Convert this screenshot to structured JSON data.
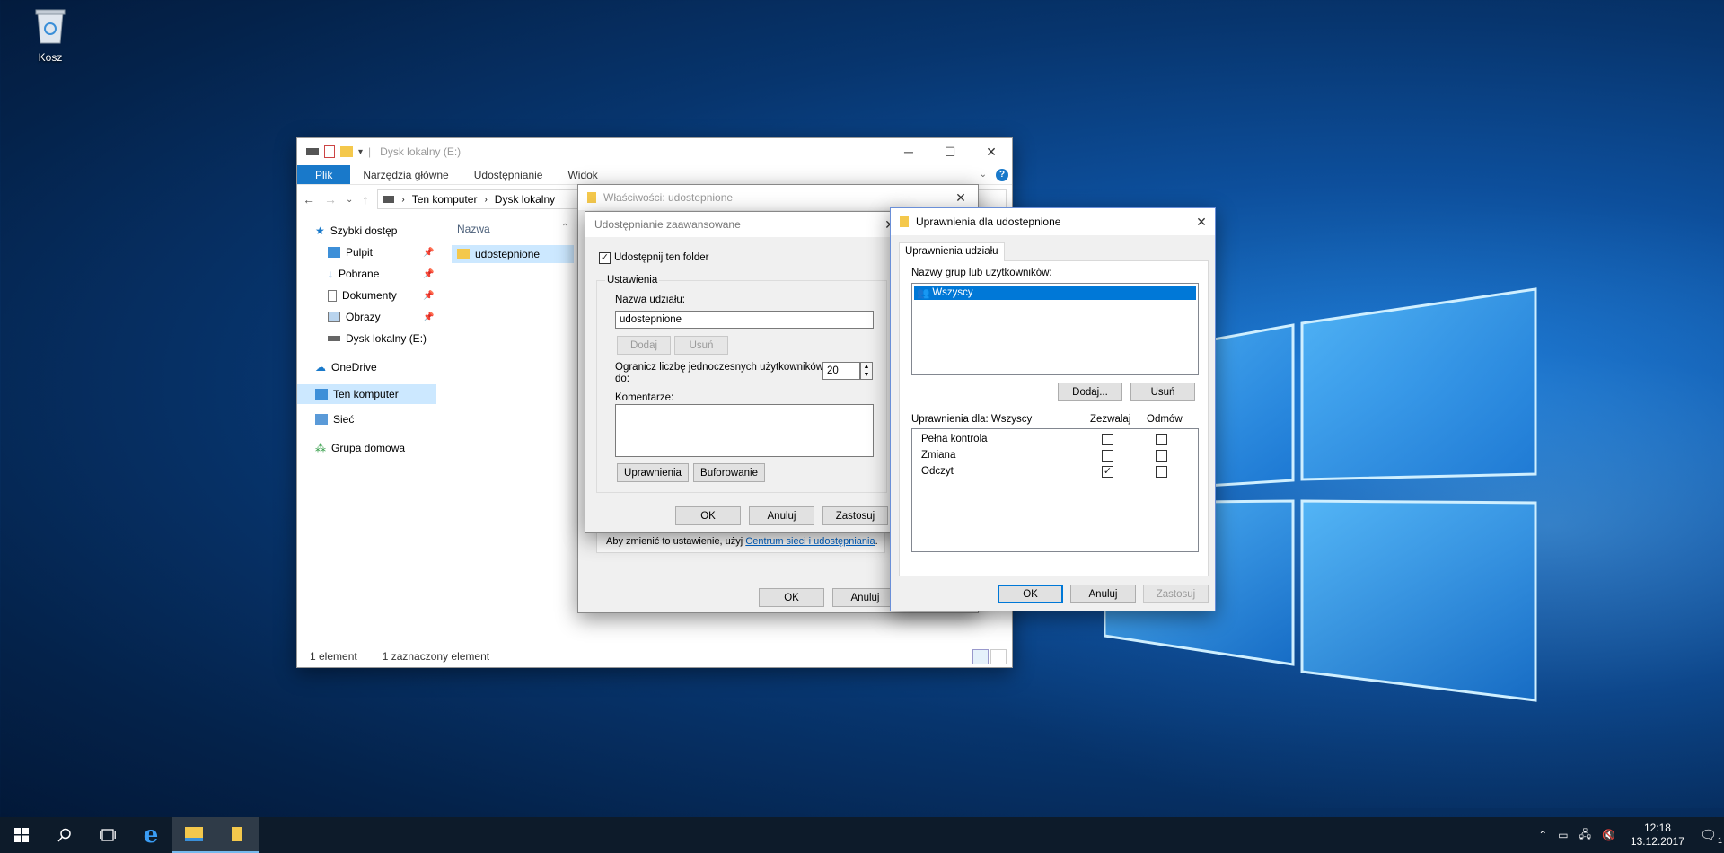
{
  "desktop": {
    "recycle_bin_label": "Kosz"
  },
  "explorer": {
    "title": "Dysk lokalny (E:)",
    "ribbon_tabs": [
      "Plik",
      "Narzędzia główne",
      "Udostępnianie",
      "Widok"
    ],
    "breadcrumb": [
      "Ten komputer",
      "Dysk lokalny"
    ],
    "nav": {
      "quick_access": "Szybki dostęp",
      "desktop": "Pulpit",
      "downloads": "Pobrane",
      "documents": "Dokumenty",
      "pictures": "Obrazy",
      "local_disk": "Dysk lokalny (E:)",
      "onedrive": "OneDrive",
      "this_pc": "Ten komputer",
      "network": "Sieć",
      "homegroup": "Grupa domowa"
    },
    "column_name": "Nazwa",
    "files": [
      "udostepnione"
    ],
    "status": {
      "count": "1 element",
      "selected": "1 zaznaczony element"
    }
  },
  "properties": {
    "title": "Właściwości: udostepnione",
    "note_text": "Aby zmienić to ustawienie, użyj ",
    "note_link": "Centrum sieci i udostępniania",
    "note_end": ".",
    "ok": "OK",
    "cancel": "Anuluj"
  },
  "advanced": {
    "title": "Udostępnianie zaawansowane",
    "share_checkbox": "Udostępnij ten folder",
    "share_checked": true,
    "settings_group": "Ustawienia",
    "share_name_label": "Nazwa udziału:",
    "share_name_value": "udostepnione",
    "add": "Dodaj",
    "remove": "Usuń",
    "limit_label_1": "Ogranicz liczbę jednoczesnych użytkowników",
    "limit_label_2": "do:",
    "limit_value": "20",
    "comments_label": "Komentarze:",
    "permissions_btn": "Uprawnienia",
    "caching_btn": "Buforowanie",
    "ok": "OK",
    "cancel": "Anuluj",
    "apply": "Zastosuj"
  },
  "permissions": {
    "title": "Uprawnienia dla udostepnione",
    "tab": "Uprawnienia udziału",
    "groups_label": "Nazwy grup lub użytkowników:",
    "groups": [
      "Wszyscy"
    ],
    "add": "Dodaj...",
    "remove": "Usuń",
    "perms_for": "Uprawnienia dla: Wszyscy",
    "allow_header": "Zezwalaj",
    "deny_header": "Odmów",
    "rows": [
      {
        "name": "Pełna kontrola",
        "allow": false,
        "deny": false
      },
      {
        "name": "Zmiana",
        "allow": false,
        "deny": false
      },
      {
        "name": "Odczyt",
        "allow": true,
        "deny": false
      }
    ],
    "ok": "OK",
    "cancel": "Anuluj",
    "apply": "Zastosuj"
  },
  "taskbar": {
    "time": "12:18",
    "date": "13.12.2017",
    "notification_count": "1"
  },
  "colors": {
    "accent": "#0078d7",
    "file_tab": "#1979ca",
    "selection": "#cce8ff"
  }
}
